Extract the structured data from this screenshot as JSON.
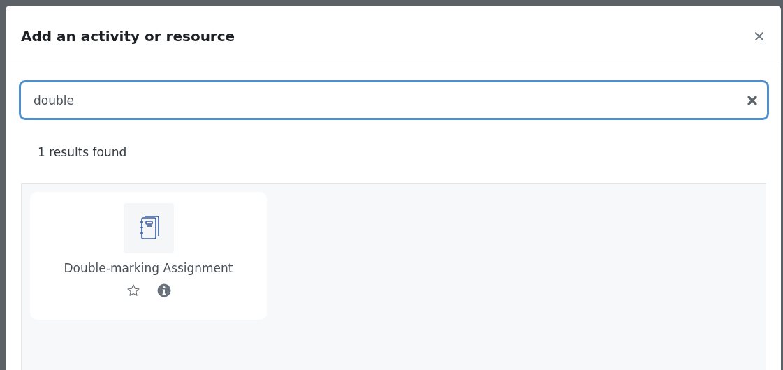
{
  "dialog": {
    "title": "Add an activity or resource"
  },
  "search": {
    "value": "double"
  },
  "results_summary": "1 results found",
  "modules": [
    {
      "name": "Double-marking Assignment",
      "starred": false
    }
  ]
}
